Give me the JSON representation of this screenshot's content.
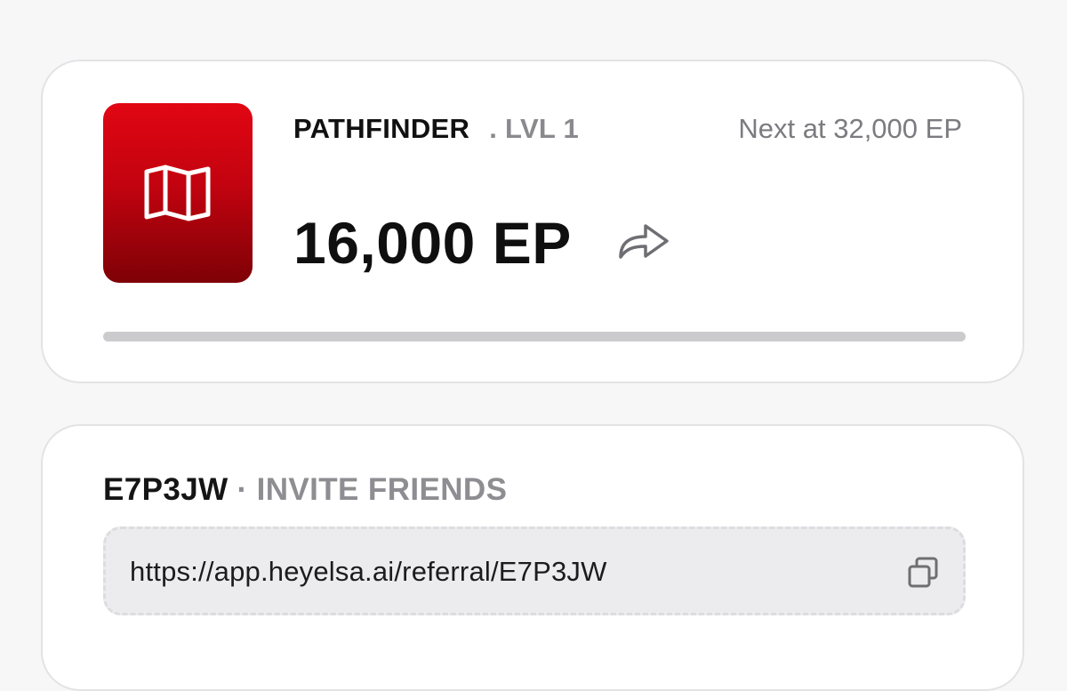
{
  "level_card": {
    "badge_icon": "folded-map-icon",
    "badge_color_top": "#e10612",
    "badge_color_bottom": "#7e0106",
    "rank_name": "PATHFINDER",
    "rank_level": ". LVL 1",
    "next_at": "Next at 32,000 EP",
    "points": "16,000 EP",
    "share_icon": "share-arrow-icon",
    "progress": 0
  },
  "invite_card": {
    "code": "E7P3JW",
    "separator": "·",
    "label": "INVITE FRIENDS",
    "link": "https://app.heyelsa.ai/referral/E7P3JW",
    "copy_icon": "copy-icon"
  }
}
